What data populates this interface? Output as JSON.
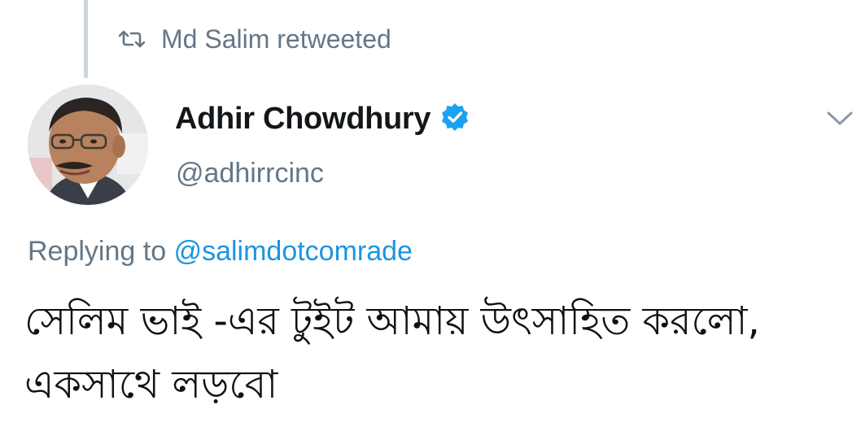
{
  "retweet": {
    "icon": "retweet-icon",
    "label": "Md Salim retweeted"
  },
  "author": {
    "name": "Adhir Chowdhury",
    "handle": "@adhirrcinc",
    "verified_icon": "verified-badge-icon",
    "avatar_icon": "avatar-photo"
  },
  "menu": {
    "icon": "chevron-down-icon"
  },
  "reply": {
    "prefix": "Replying to",
    "target": "@salimdotcomrade"
  },
  "tweet": {
    "text": "সেলিম ভাই -এর টুইট আমায় উৎসাহিত করলো, একসাথে লড়বো"
  },
  "colors": {
    "link": "#1b95e0",
    "secondary_text": "#657786",
    "verified": "#1da1f2",
    "primary_text": "#14171a"
  }
}
